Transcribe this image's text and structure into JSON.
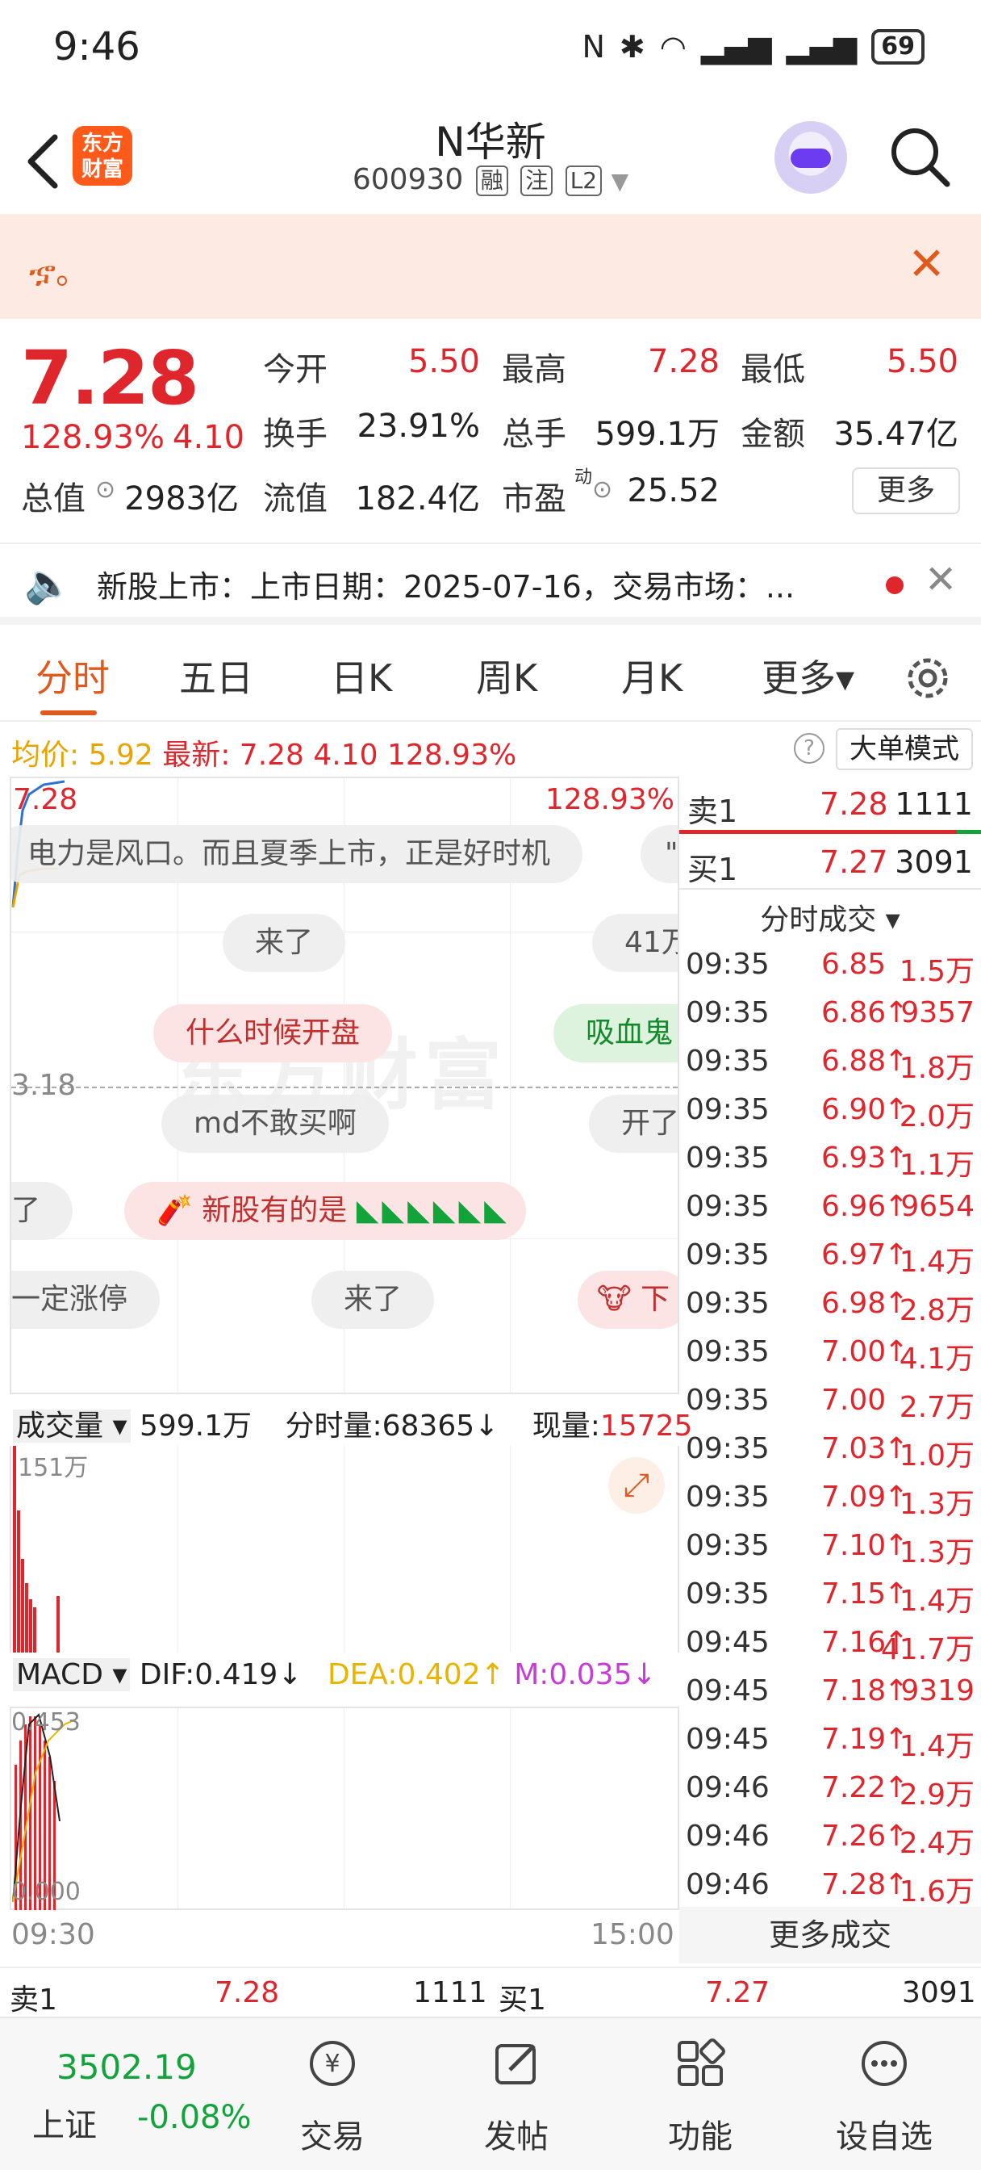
{
  "status_bar": {
    "time": "9:46",
    "battery": "69"
  },
  "header": {
    "back_label": "‹",
    "logo_text": "东方财富",
    "title": "N华新",
    "code": "600930",
    "tags": [
      "融",
      "注",
      "L2"
    ]
  },
  "notice": {
    "text": "ኇ。",
    "close": "✕"
  },
  "quote": {
    "price": "7.28",
    "change_pct": "128.93%",
    "change": "4.10",
    "fields": {
      "open_label": "今开",
      "open": "5.50",
      "high_label": "最高",
      "high": "7.28",
      "low_label": "最低",
      "low": "5.50",
      "turnover_label": "换手",
      "turnover": "23.91%",
      "volume_label": "总手",
      "volume": "599.1万",
      "amount_label": "金额",
      "amount": "35.47亿",
      "mktcap_label": "总值",
      "mktcap": "2983亿",
      "float_label": "流值",
      "float": "182.4亿",
      "pe_label": "市盈",
      "pe_sup": "动",
      "pe": "25.52"
    },
    "more_label": "更多"
  },
  "ticker": {
    "text": "新股上市：上市日期：2025-07-16，交易市场：..."
  },
  "tabs": [
    "分时",
    "五日",
    "日K",
    "周K",
    "月K",
    "更多▾"
  ],
  "info_line": {
    "avg_label": "均价:",
    "avg": "5.92",
    "latest_label": "最新:",
    "latest": "7.28",
    "chg": "4.10",
    "pct": "128.93%",
    "help": "?",
    "big_order": "大单模式"
  },
  "chart": {
    "price_top": "7.28",
    "pct_top": "128.93%",
    "mid_price": "3.18",
    "watermark": "东方财富"
  },
  "danmaku": [
    "电力是风口。而且夏季上市，正是好时机",
    "来了",
    "41万",
    "什么时候开盘",
    "吸血鬼",
    "md不敢买啊",
    "开了",
    "了",
    "新股有的是",
    "一定涨停",
    "来了",
    "下"
  ],
  "orderbook": [
    {
      "label": "卖1",
      "price": "7.28",
      "vol": "1111"
    },
    {
      "label": "买1",
      "price": "7.27",
      "vol": "3091"
    }
  ],
  "trades_title": "分时成交 ▾",
  "trades": [
    {
      "t": "09:35",
      "p": "6.85",
      "v": "1.5万",
      "a": " "
    },
    {
      "t": "09:35",
      "p": "6.86",
      "v": "9357",
      "a": "↑"
    },
    {
      "t": "09:35",
      "p": "6.88",
      "v": "1.8万",
      "a": "↑"
    },
    {
      "t": "09:35",
      "p": "6.90",
      "v": "2.0万",
      "a": "↑"
    },
    {
      "t": "09:35",
      "p": "6.93",
      "v": "1.1万",
      "a": "↑"
    },
    {
      "t": "09:35",
      "p": "6.96",
      "v": "9654",
      "a": "↑"
    },
    {
      "t": "09:35",
      "p": "6.97",
      "v": "1.4万",
      "a": "↑"
    },
    {
      "t": "09:35",
      "p": "6.98",
      "v": "2.8万",
      "a": "↑"
    },
    {
      "t": "09:35",
      "p": "7.00",
      "v": "4.1万",
      "a": "↑"
    },
    {
      "t": "09:35",
      "p": "7.00",
      "v": "2.7万",
      "a": " "
    },
    {
      "t": "09:35",
      "p": "7.03",
      "v": "1.0万",
      "a": "↑"
    },
    {
      "t": "09:35",
      "p": "7.09",
      "v": "1.3万",
      "a": "↑"
    },
    {
      "t": "09:35",
      "p": "7.10",
      "v": "1.3万",
      "a": "↑"
    },
    {
      "t": "09:35",
      "p": "7.15",
      "v": "1.4万",
      "a": "↑"
    },
    {
      "t": "09:45",
      "p": "7.16",
      "v": "41.7万",
      "a": "↑"
    },
    {
      "t": "09:45",
      "p": "7.18",
      "v": "9319",
      "a": "↑"
    },
    {
      "t": "09:45",
      "p": "7.19",
      "v": "1.4万",
      "a": "↑"
    },
    {
      "t": "09:46",
      "p": "7.22",
      "v": "2.9万",
      "a": "↑"
    },
    {
      "t": "09:46",
      "p": "7.26",
      "v": "2.4万",
      "a": "↑"
    },
    {
      "t": "09:46",
      "p": "7.28",
      "v": "1.6万",
      "a": "↑"
    }
  ],
  "more_trades": "更多成交",
  "volume": {
    "label": "成交量 ▾",
    "total": "599.1万",
    "period_label": "分时量:",
    "period": "68365↓",
    "now_label": "现量:",
    "now": "15725",
    "max": "151万"
  },
  "macd": {
    "label": "MACD ▾",
    "dif": "DIF:0.419↓",
    "dea": "DEA:0.402↑",
    "m": "M:0.035↓",
    "top": "0.453",
    "bottom": "0.000",
    "start": "09:30",
    "end": "15:00"
  },
  "book_row": {
    "sell_label": "卖1",
    "sell_price": "7.28",
    "sell_vol": "1111",
    "buy_label": "买1",
    "buy_price": "7.27",
    "buy_vol": "3091"
  },
  "index": {
    "value": "3502.19",
    "name": "上证",
    "pct": "-0.08%"
  },
  "bottom_nav": [
    "交易",
    "发帖",
    "功能",
    "设自选"
  ],
  "colors": {
    "up": "#e0262d",
    "down": "#12a33b",
    "accent": "#e05a1e"
  }
}
